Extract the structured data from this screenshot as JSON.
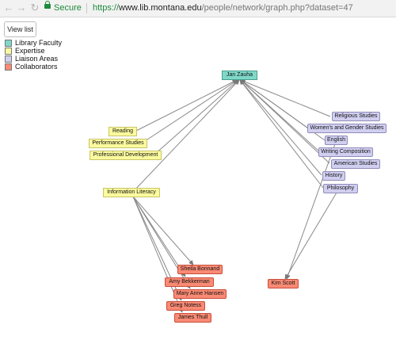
{
  "browser": {
    "secure_label": "Secure",
    "url_scheme": "https://",
    "url_host": "www.lib.montana.edu",
    "url_path": "/people/network/graph.php?dataset=47"
  },
  "toolbar": {
    "view_list_label": "View list"
  },
  "legend": [
    {
      "label": "Library Faculty",
      "color": "#7fd8c8"
    },
    {
      "label": "Expertise",
      "color": "#fbfa9e"
    },
    {
      "label": "Liaison Areas",
      "color": "#d1cff0"
    },
    {
      "label": "Collaborators",
      "color": "#f98a74"
    }
  ],
  "graph": {
    "faculty": "Jan Zauha",
    "expertise": [
      "Reading",
      "Performance Studies",
      "Professional Development",
      "Information Literacy"
    ],
    "liaison": [
      "Religious Studies",
      "Women's and Gender Studies",
      "English",
      "Writing Composition",
      "American Studies",
      "History",
      "Philosophy"
    ],
    "collaborators": [
      "Sheila Bonnand",
      "Amy Bekkerman",
      "Mary Anne Hansen",
      "Greg Notess",
      "James Thull",
      "Kim Scott"
    ]
  }
}
